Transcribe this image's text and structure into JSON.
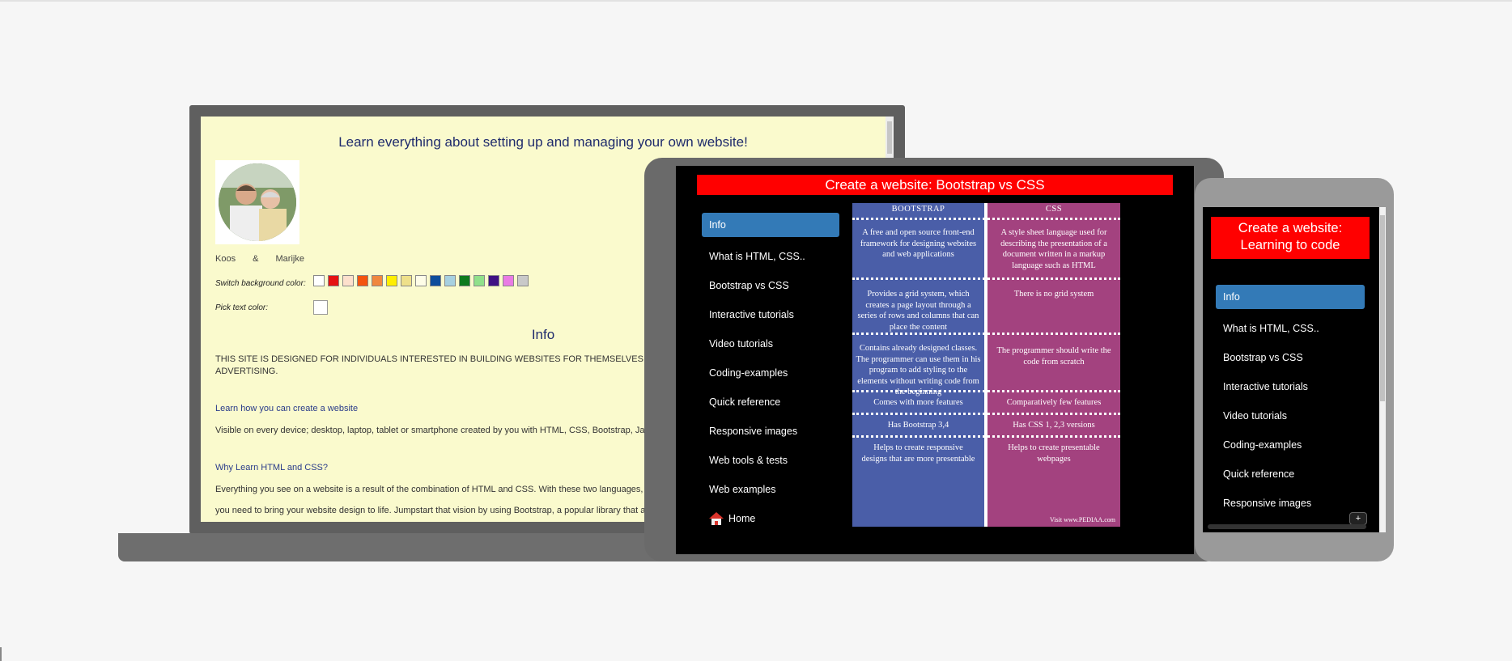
{
  "laptop": {
    "headline": "Learn everything about setting up and managing your own website!",
    "names": "Koos & Marijke",
    "bg_color_label": "Switch background color:",
    "swatches": [
      "#ffffff",
      "#e51212",
      "#fde0cc",
      "#f4540f",
      "#f0873f",
      "#ffee00",
      "#eee08a",
      "#fefde8",
      "#0e4d9c",
      "#a7d0e0",
      "#0d7a1e",
      "#90e08a",
      "#3f1084",
      "#e97ae4",
      "#c9c9c9"
    ],
    "text_color_label": "Pick text color:",
    "section_title": "Info",
    "upper_text": "THIS SITE IS DESIGNED FOR INDIVIDUALS INTERESTED IN BUILDING WEBSITES FOR THEMSELVES W ADVERTISING.",
    "link1": "Learn how you can create a website",
    "text1": "Visible on every device; desktop, laptop, tablet or smartphone created by you with HTML, CSS, Bootstrap, Jav",
    "link2": "Why Learn HTML and CSS?",
    "text2": "Everything you see on a website is a result of the combination of HTML and CSS. With these two languages, y",
    "text3": "you need to bring your website design to life. Jumpstart that vision by using Bootstrap, a popular library that al"
  },
  "tablet": {
    "title": "Create a website: Bootstrap vs CSS",
    "menu": [
      "Info",
      "What is HTML, CSS..",
      "Bootstrap vs CSS",
      "Interactive tutorials",
      "Video tutorials",
      "Coding-examples",
      "Quick reference",
      "Responsive images",
      "Web tools & tests",
      "Web examples"
    ],
    "home_label": "Home",
    "comparison": {
      "head_left": "BOOTSTRAP",
      "head_right": "CSS",
      "rows": [
        {
          "left": "A free and open source front-end framework for designing websites and web applications",
          "right": "A style sheet language used for describing the presentation of a document written in a markup language such as HTML"
        },
        {
          "left": "Provides a grid system, which creates a page layout through a series of rows and columns that can place the content",
          "right": "There is no grid system"
        },
        {
          "left": "Contains already designed classes. The programmer can use them in his program to add styling to the elements without writing code from the beginning",
          "right": "The programmer should write the code from scratch"
        },
        {
          "left": "Comes with more features",
          "right": "Comparatively few features"
        },
        {
          "left": "Has Bootstrap 3,4",
          "right": "Has CSS 1, 2,3 versions"
        },
        {
          "left": "Helps to create responsive designs that are more presentable",
          "right": "Helps to create presentable webpages"
        }
      ],
      "footer": "Visit www.PEDIAA.com"
    }
  },
  "phone": {
    "title": "Create a website: Learning to code",
    "menu": [
      "Info",
      "What is HTML, CSS..",
      "Bootstrap vs CSS",
      "Interactive tutorials",
      "Video tutorials",
      "Coding-examples",
      "Quick reference",
      "Responsive images"
    ],
    "toggle_label": "+"
  }
}
